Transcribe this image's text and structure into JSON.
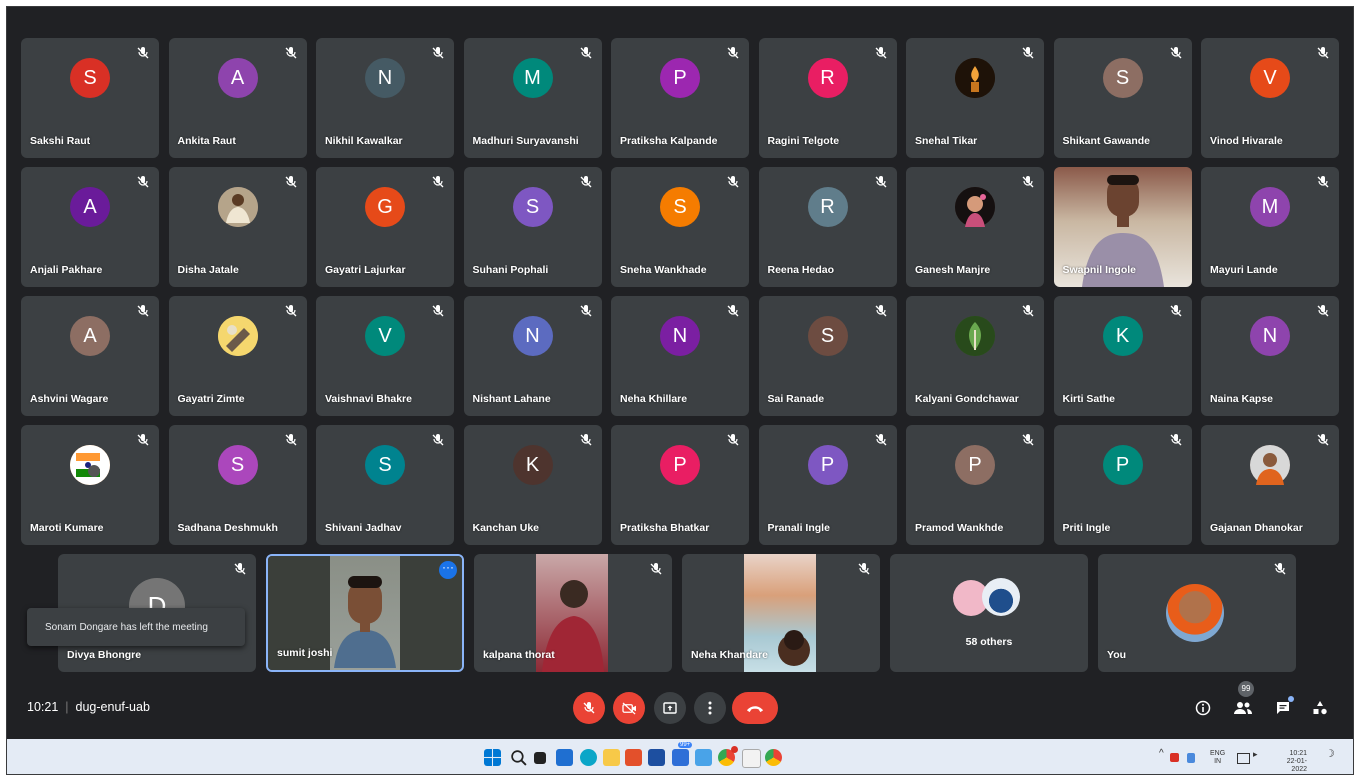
{
  "meeting": {
    "time": "10:21",
    "code": "dug-enuf-uab"
  },
  "toast": "Sonam Dongare has left the meeting",
  "participants": [
    {
      "name": "Sakshi Raut",
      "initial": "S",
      "color": "#d93025"
    },
    {
      "name": "Ankita Raut",
      "initial": "A",
      "color": "#8e44ad"
    },
    {
      "name": "Nikhil Kawalkar",
      "initial": "N",
      "color": "#455a64"
    },
    {
      "name": "Madhuri Suryavanshi",
      "initial": "M",
      "color": "#00897b"
    },
    {
      "name": "Pratiksha Kalpande",
      "initial": "P",
      "color": "#9c27b0"
    },
    {
      "name": "Ragini Telgote",
      "initial": "R",
      "color": "#e91e63"
    },
    {
      "name": "Snehal Tikar",
      "photo": "candle",
      "color": "#2b1a0a"
    },
    {
      "name": "Shikant Gawande",
      "initial": "S",
      "color": "#8d6e63"
    },
    {
      "name": "Vinod Hivarale",
      "initial": "V",
      "color": "#e64a19"
    },
    {
      "name": "Anjali Pakhare",
      "initial": "A",
      "color": "#6a1b9a"
    },
    {
      "name": "Disha Jatale",
      "photo": "person",
      "color": "#a1887f"
    },
    {
      "name": "Gayatri Lajurkar",
      "initial": "G",
      "color": "#e64a19"
    },
    {
      "name": "Suhani Pophali",
      "initial": "S",
      "color": "#7e57c2"
    },
    {
      "name": "Sneha Wankhade",
      "initial": "S",
      "color": "#f57c00"
    },
    {
      "name": "Reena Hedao",
      "initial": "R",
      "color": "#607d8b"
    },
    {
      "name": "Ganesh Manjre",
      "photo": "child",
      "color": "#3e2723"
    },
    {
      "name": "Swapnil Ingole",
      "video": true
    },
    {
      "name": "Mayuri Lande",
      "initial": "M",
      "color": "#8e44ad"
    },
    {
      "name": "Ashvini Wagare",
      "initial": "A",
      "color": "#8d6e63"
    },
    {
      "name": "Gayatri Zimte",
      "photo": "art",
      "color": "#f4d35e"
    },
    {
      "name": "Vaishnavi Bhakre",
      "initial": "V",
      "color": "#00897b"
    },
    {
      "name": "Nishant Lahane",
      "initial": "N",
      "color": "#5c6bc0"
    },
    {
      "name": "Neha Khillare",
      "initial": "N",
      "color": "#7b1fa2"
    },
    {
      "name": "Sai Ranade",
      "initial": "S",
      "color": "#6d4c41"
    },
    {
      "name": "Kalyani Gondchawar",
      "photo": "leaf",
      "color": "#33691e"
    },
    {
      "name": "Kirti Sathe",
      "initial": "K",
      "color": "#00897b"
    },
    {
      "name": "Naina Kapse",
      "initial": "N",
      "color": "#8e44ad"
    },
    {
      "name": "Maroti Kumare",
      "photo": "flag",
      "color": "#ff9933"
    },
    {
      "name": "Sadhana Deshmukh",
      "initial": "S",
      "color": "#ab47bc"
    },
    {
      "name": "Shivani Jadhav",
      "initial": "S",
      "color": "#00838f"
    },
    {
      "name": "Kanchan Uke",
      "initial": "K",
      "color": "#4e342e"
    },
    {
      "name": "Pratiksha Bhatkar",
      "initial": "P",
      "color": "#e91e63"
    },
    {
      "name": "Pranali Ingle",
      "initial": "P",
      "color": "#7e57c2"
    },
    {
      "name": "Pramod Wankhde",
      "initial": "P",
      "color": "#8d6e63"
    },
    {
      "name": "Priti Ingle",
      "initial": "P",
      "color": "#00897b"
    },
    {
      "name": "Gajanan Dhanokar",
      "photo": "man",
      "color": "#5d4037"
    }
  ],
  "bottom_row": [
    {
      "name": "Divya Bhongre",
      "initial": "D",
      "color": "#757575",
      "muted": true
    },
    {
      "name": "sumit joshi",
      "video": true,
      "active": true
    },
    {
      "name": "kalpana thorat",
      "video": true,
      "muted": true
    },
    {
      "name": "Neha Khandare",
      "video": true,
      "muted": true
    }
  ],
  "others_label": "58 others",
  "you_label": "You",
  "people_count": "99",
  "taskbar": {
    "badge": "99+",
    "lang_top": "ENG",
    "lang_bottom": "IN",
    "clock_time": "10:21",
    "clock_date": "22-01-2022"
  }
}
